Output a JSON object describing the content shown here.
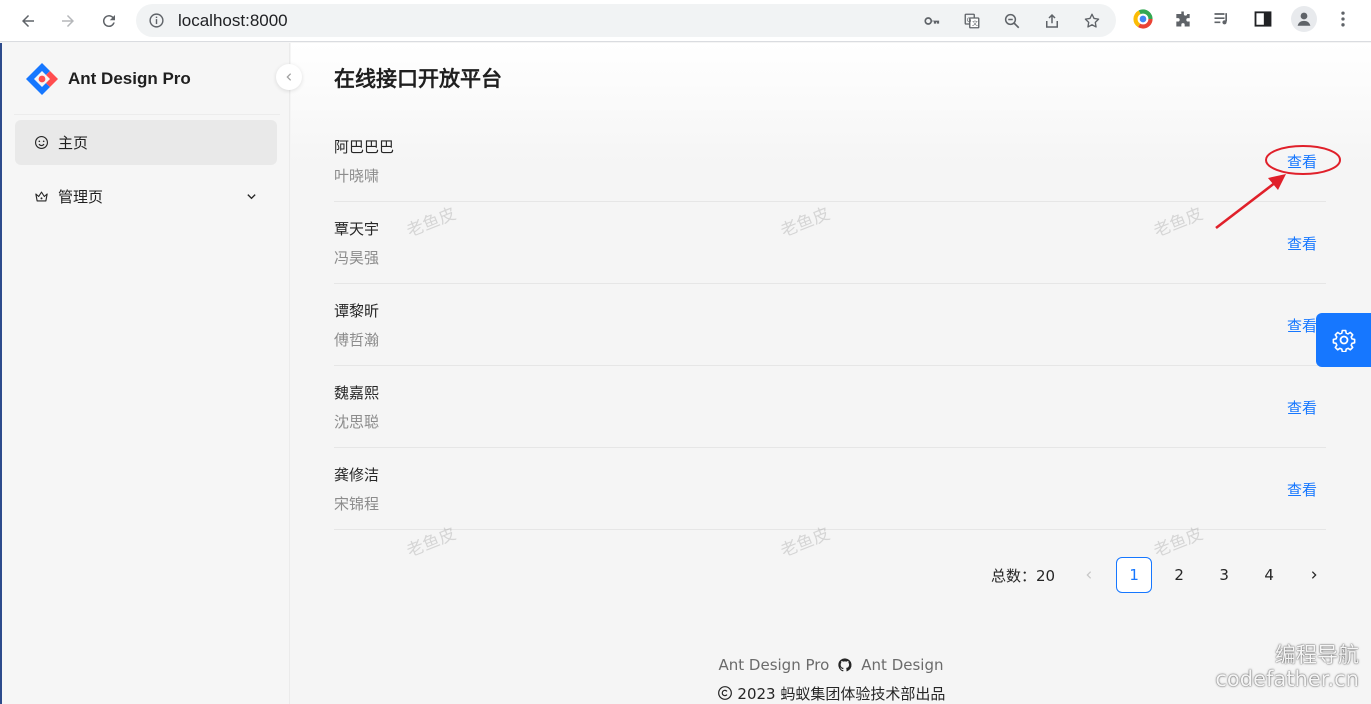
{
  "browser": {
    "url": "localhost:8000"
  },
  "sidebar": {
    "brand": "Ant Design Pro",
    "items": [
      {
        "label": "主页",
        "icon": "smile-icon",
        "active": true
      },
      {
        "label": "管理页",
        "icon": "crown-icon",
        "active": false
      }
    ]
  },
  "main": {
    "title": "在线接口开放平台",
    "rows": [
      {
        "title": "阿巴巴巴",
        "desc": "叶晓啸",
        "action": "查看"
      },
      {
        "title": "覃天宇",
        "desc": "冯昊强",
        "action": "查看"
      },
      {
        "title": "谭黎昕",
        "desc": "傅哲瀚",
        "action": "查看"
      },
      {
        "title": "魏嘉熙",
        "desc": "沈思聪",
        "action": "查看"
      },
      {
        "title": "龚修洁",
        "desc": "宋锦程",
        "action": "查看"
      }
    ],
    "watermark": "老鱼皮",
    "pagination": {
      "total_label": "总数：20",
      "pages": [
        "1",
        "2",
        "3",
        "4"
      ],
      "current": "1"
    }
  },
  "footer": {
    "link1": "Ant Design Pro",
    "link2": "Ant Design",
    "copyright": "2023 蚂蚁集团体验技术部出品"
  },
  "overlay": {
    "line1": "编程导航",
    "line2": "codefather.cn"
  },
  "colors": {
    "primary": "#1677ff",
    "annotation": "#e0202a"
  }
}
